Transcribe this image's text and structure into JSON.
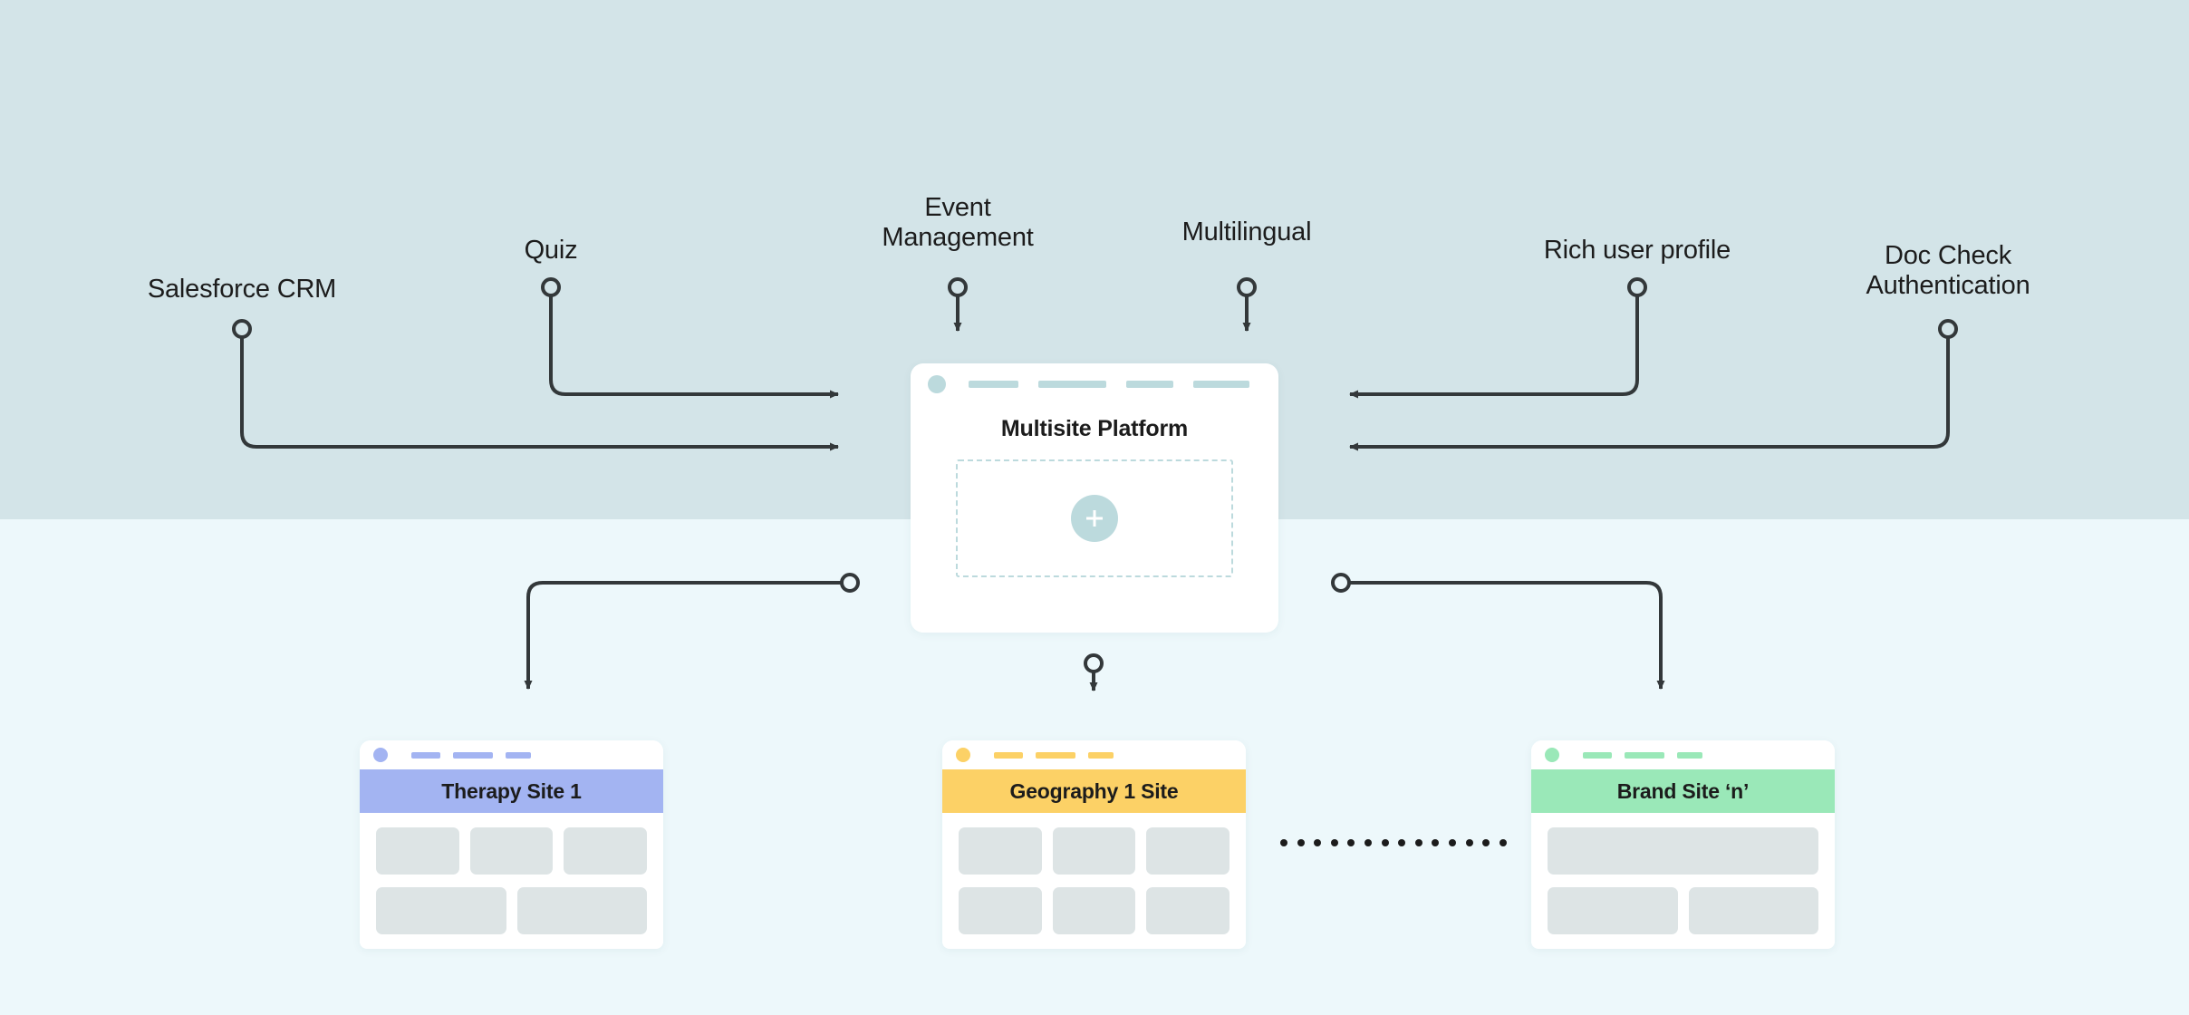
{
  "colors": {
    "band_top": "#d3e4e8",
    "band_bottom": "#edf8fb",
    "wire": "#33383a",
    "platform_accent": "#bcdadd",
    "therapy_accent": "#a3b4f2",
    "geography_accent": "#fcd166",
    "brand_accent": "#9ae8b8",
    "placeholder_block": "#dde4e5",
    "text": "#1c1c1c"
  },
  "inputs": {
    "left": [
      {
        "label": "Salesforce CRM",
        "node_name": "node-salesforce-crm"
      },
      {
        "label": "Quiz",
        "node_name": "node-quiz"
      }
    ],
    "top": [
      {
        "label": "Event\nManagement",
        "node_name": "node-event-management"
      },
      {
        "label": "Multilingual",
        "node_name": "node-multilingual"
      }
    ],
    "right": [
      {
        "label": "Rich user profile",
        "node_name": "node-rich-user-profile"
      },
      {
        "label": "Doc Check\nAuthentication",
        "node_name": "node-doc-check-authentication"
      }
    ]
  },
  "platform": {
    "title": "Multisite Platform",
    "plus_icon": "plus-icon",
    "dot_icon": "window-dot-icon",
    "nav_bars": 4,
    "dropzone": "drop-area"
  },
  "sites": [
    {
      "title": "Therapy Site 1",
      "accent": "#a3b4f2",
      "dot": "#a3b4f2",
      "layout": "3-2"
    },
    {
      "title": "Geography 1 Site",
      "accent": "#fcd166",
      "dot": "#fcd166",
      "layout": "3-3"
    },
    {
      "title": "Brand Site ‘n’",
      "accent": "#9ae8b8",
      "dot": "#9ae8b8",
      "layout": "1-2"
    }
  ],
  "separator": {
    "name": "ellipsis-separator",
    "dot_count": 14
  }
}
